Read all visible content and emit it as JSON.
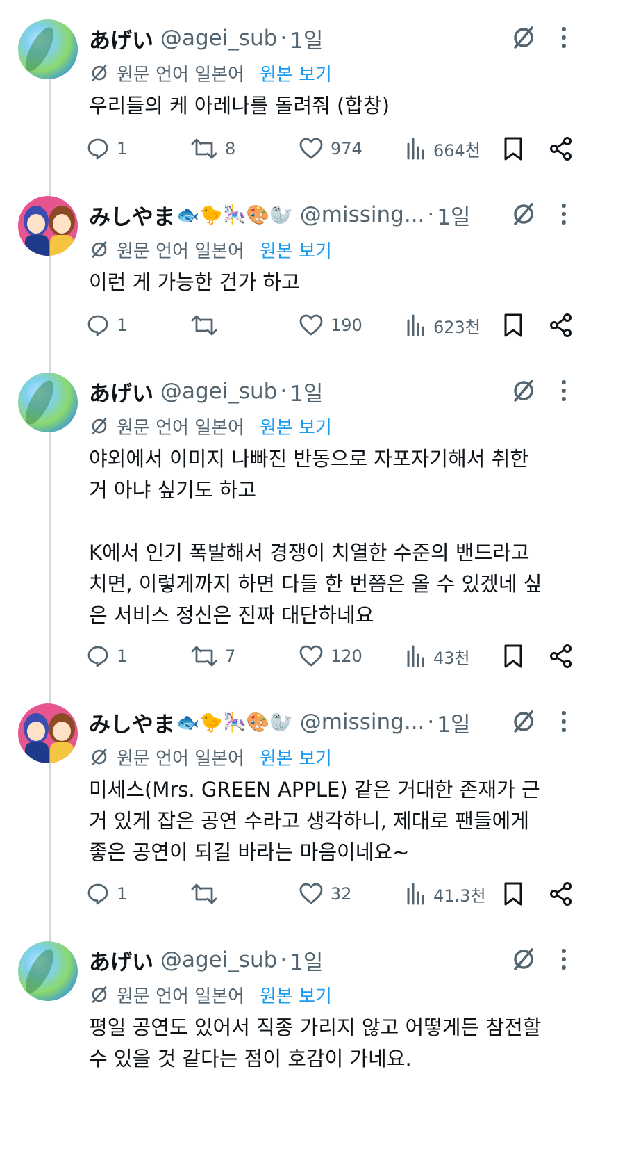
{
  "translation": {
    "label": "원문 언어 일본어",
    "link": "원본 보기"
  },
  "icons": [
    "translate-icon",
    "more-icon",
    "reply-icon",
    "retweet-icon",
    "like-icon",
    "views-icon",
    "bookmark-icon",
    "share-icon"
  ],
  "colors": {
    "text": "#0f1419",
    "muted": "#536471",
    "link": "#1d9bf0",
    "thread_line": "#cfd9de"
  },
  "tweets": [
    {
      "name": "あげい",
      "emoji": "",
      "handle": "@agei_sub",
      "time": "1일",
      "text": "우리들의 케 아레나를 돌려줘 (합창)",
      "replies": "1",
      "retweets": "8",
      "likes": "974",
      "views": "664천"
    },
    {
      "name": "みしやま",
      "emoji": "🐟🐤🎠🎨🦭",
      "handle": "@missing...",
      "time": "1일",
      "text": "이런 게 가능한 건가 하고",
      "replies": "1",
      "retweets": "",
      "likes": "190",
      "views": "623천"
    },
    {
      "name": "あげい",
      "emoji": "",
      "handle": "@agei_sub",
      "time": "1일",
      "text": "야외에서 이미지 나빠진 반동으로 자포자기해서 취한\n거 아냐 싶기도 하고\n\nK에서 인기 폭발해서 경쟁이 치열한 수준의 밴드라고\n치면, 이렇게까지 하면 다들 한 번쯤은 올 수 있겠네 싶\n은 서비스 정신은 진짜 대단하네요",
      "replies": "1",
      "retweets": "7",
      "likes": "120",
      "views": "43천"
    },
    {
      "name": "みしやま",
      "emoji": "🐟🐤🎠🎨🦭",
      "handle": "@missing...",
      "time": "1일",
      "text": "미세스(Mrs. GREEN APPLE) 같은 거대한 존재가 근\n거 있게 잡은 공연 수라고 생각하니, 제대로 팬들에게\n좋은 공연이 되길 바라는 마음이네요~",
      "replies": "1",
      "retweets": "",
      "likes": "32",
      "views": "41.3천"
    },
    {
      "name": "あげい",
      "emoji": "",
      "handle": "@agei_sub",
      "time": "1일",
      "text": "평일 공연도 있어서 직종 가리지 않고 어떻게든 참전할\n수 있을 것 같다는 점이 호감이 가네요.",
      "replies": "",
      "retweets": "",
      "likes": "",
      "views": ""
    }
  ]
}
